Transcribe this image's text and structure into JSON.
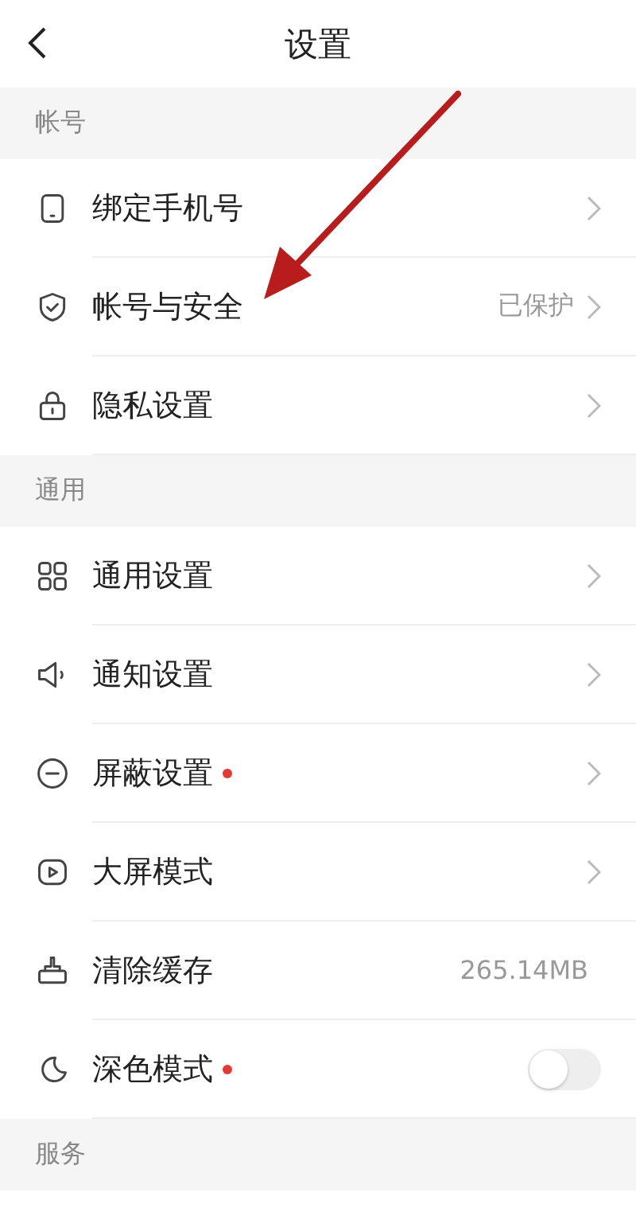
{
  "header": {
    "title": "设置"
  },
  "sections": [
    {
      "title": "帐号",
      "items": [
        {
          "label": "绑定手机号",
          "kind": "chevron",
          "dot": false
        },
        {
          "label": "帐号与安全",
          "kind": "chevron",
          "value": "已保护",
          "dot": false
        },
        {
          "label": "隐私设置",
          "kind": "chevron",
          "dot": false
        }
      ]
    },
    {
      "title": "通用",
      "items": [
        {
          "label": "通用设置",
          "kind": "chevron",
          "dot": false
        },
        {
          "label": "通知设置",
          "kind": "chevron",
          "dot": false
        },
        {
          "label": "屏蔽设置",
          "kind": "chevron",
          "dot": true
        },
        {
          "label": "大屏模式",
          "kind": "chevron",
          "dot": false
        },
        {
          "label": "清除缓存",
          "kind": "value",
          "value": "265.14MB",
          "dot": false
        },
        {
          "label": "深色模式",
          "kind": "toggle",
          "on": false,
          "dot": true
        }
      ]
    },
    {
      "title": "服务"
    }
  ],
  "annotation": {
    "kind": "arrow"
  }
}
